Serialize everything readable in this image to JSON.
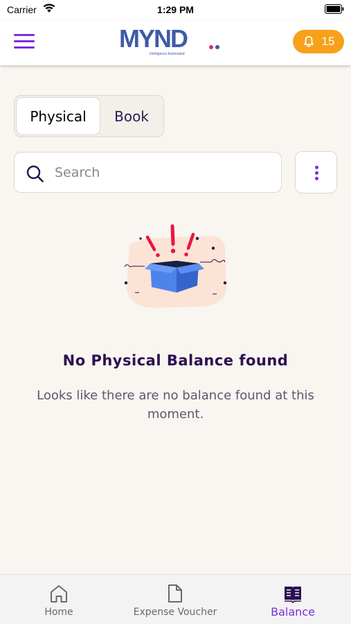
{
  "status_bar": {
    "carrier": "Carrier",
    "time": "1:29 PM"
  },
  "header": {
    "logo_text": "MYND",
    "logo_tagline": "Intelligence Automated",
    "notification_count": "15",
    "accent_color": "#7b2ee0",
    "badge_color": "#f7a11a"
  },
  "tabs": [
    {
      "label": "Physical",
      "selected": true
    },
    {
      "label": "Book",
      "selected": false
    }
  ],
  "search": {
    "placeholder": "Search",
    "value": ""
  },
  "empty_state": {
    "illustration": "open-box-alert-illustration",
    "title": "No Physical Balance found",
    "message": "Looks like there are no balance found at this moment."
  },
  "bottom_nav": {
    "items": [
      {
        "label": "Home",
        "icon": "home-icon",
        "active": false
      },
      {
        "label": "Expense Voucher",
        "icon": "document-icon",
        "active": false
      },
      {
        "label": "Balance",
        "icon": "book-icon",
        "active": true
      }
    ]
  }
}
